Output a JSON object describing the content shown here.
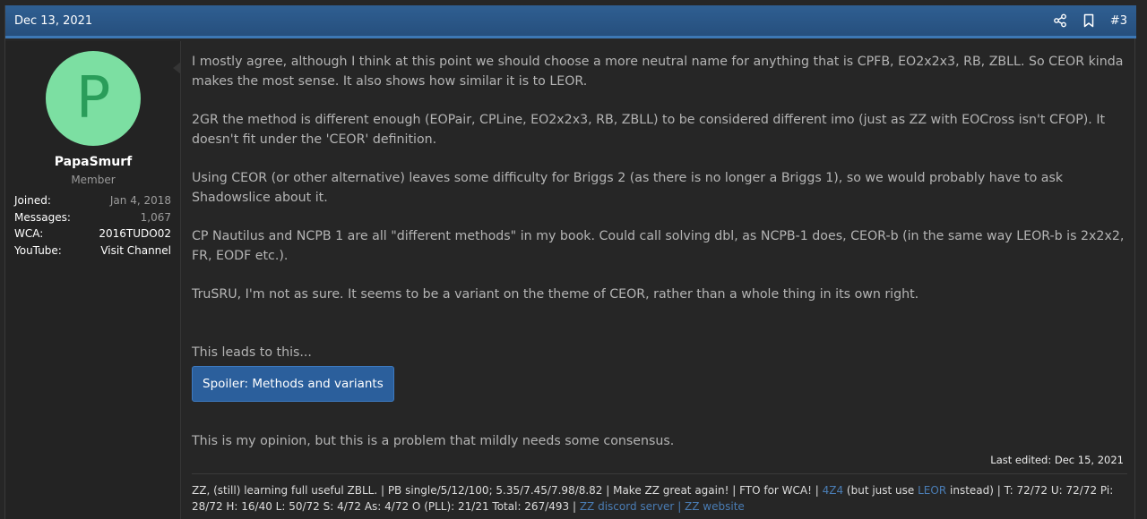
{
  "post": {
    "date": "Dec 13, 2021",
    "number": "#3",
    "last_edited": "Last edited: Dec 15, 2021"
  },
  "user": {
    "avatar_letter": "P",
    "name": "PapaSmurf",
    "title": "Member",
    "stats": [
      {
        "label": "Joined:",
        "value": "Jan 4, 2018"
      },
      {
        "label": "Messages:",
        "value": "1,067"
      },
      {
        "label": "WCA:",
        "value": "2016TUDO02"
      },
      {
        "label": "YouTube:",
        "value": "Visit Channel"
      }
    ]
  },
  "body": {
    "p1": "I mostly agree, although I think at this point we should choose a more neutral name for anything that is CPFB, EO2x2x3, RB, ZBLL. So CEOR kinda makes the most sense. It also shows how similar it is to LEOR.",
    "p2": "2GR the method is different enough (EOPair, CPLine, EO2x2x3, RB, ZBLL) to be considered different imo (just as ZZ with EOCross isn't CFOP). It doesn't fit under the 'CEOR' definition.",
    "p3": "Using CEOR (or other alternative) leaves some difficulty for Briggs 2 (as there is no longer a Briggs 1), so we would probably have to ask Shadowslice about it.",
    "p4": "CP Nautilus and NCPB 1 are all \"different methods\" in my book. Could call solving dbl, as NCPB-1 does, CEOR-b (in the same way LEOR-b is 2x2x2, FR, EODF etc.).",
    "p5": "TruSRU, I'm not as sure. It seems to be a variant on the theme of CEOR, rather than a whole thing in its own right.",
    "p6": "This leads to this...",
    "spoiler_label": "Spoiler: Methods and variants",
    "p7": "This is my opinion, but this is a problem that mildly needs some consensus."
  },
  "signature": {
    "part1": "ZZ, (still) learning full useful ZBLL. | PB single/5/12/100; 5.35/7.45/7.98/8.82 | Make ZZ great again! | FTO for WCA! | ",
    "link_4z4": "4Z4",
    "part2": " (but just use ",
    "link_leor": "LEOR",
    "part3": " instead) | T: 72/72 U: 72/72 Pi: 28/72 H: 16/40 L: 50/72 S: 4/72 As: 4/72 O (PLL): 21/21 Total: 267/493 | ",
    "link_discord": "ZZ discord server",
    "sep": " | ",
    "link_website": "ZZ website"
  },
  "colors": {
    "header_bg": "#2f5f92",
    "avatar_bg": "#7cdfa2",
    "avatar_fg": "#2a9d5a",
    "spoiler_bg": "#2b5f9c",
    "link": "#4a7db5"
  },
  "icons": [
    "share-icon",
    "bookmark-icon"
  ]
}
